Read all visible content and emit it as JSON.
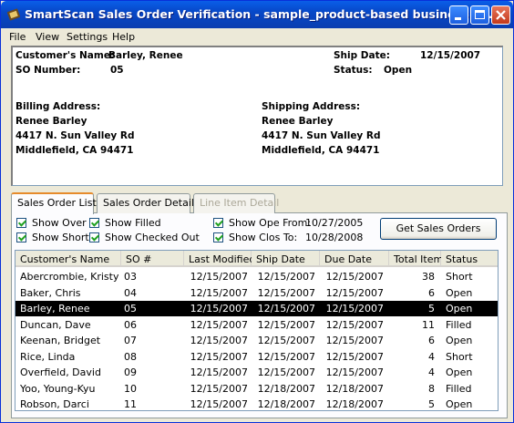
{
  "window": {
    "title": "SmartScan Sales Order Verification - sample_product-based business As...",
    "colors": {
      "titlebar": "#0a5ee8",
      "selected_row": "#000000",
      "window_bg": "#ece9d8"
    }
  },
  "menu": {
    "file": "File",
    "view": "View",
    "settings": "Settings",
    "help": "Help"
  },
  "order": {
    "customer_label": "Customer's Name:",
    "customer_value": "Barley, Renee",
    "so_label": "SO Number:",
    "so_value": "05",
    "ship_date_label": "Ship Date:",
    "ship_date_value": "12/15/2007",
    "status_label": "Status:",
    "status_value": "Open",
    "billing_label": "Billing Address:",
    "billing_lines": [
      "Renee Barley",
      "4417 N. Sun Valley Rd",
      "Middlefield, CA 94471"
    ],
    "shipping_label": "Shipping Address:",
    "shipping_lines": [
      "Renee Barley",
      "4417 N. Sun Valley Rd",
      "Middlefield, CA 94471"
    ]
  },
  "tabs": [
    "Sales Order List",
    "Sales Order Detail",
    "Line Item Detail"
  ],
  "filters": {
    "show_over": "Show Over",
    "show_short": "Show Short",
    "show_filled": "Show Filled",
    "show_checked_out": "Show Checked Out",
    "show_open_from": "Show Ope From:",
    "open_from_date": "10/27/2005",
    "show_closed_to": "Show Clos To:",
    "closed_to_date": "10/28/2008",
    "get_orders": "Get Sales Orders"
  },
  "table": {
    "columns": [
      "Customer's Name",
      "SO #",
      "Last Modified",
      "Ship Date",
      "Due Date",
      "Total Item",
      "Status"
    ],
    "rows": [
      [
        "Abercrombie, Kristy",
        "03",
        "12/15/2007",
        "12/15/2007",
        "12/15/2007",
        "38",
        "Short"
      ],
      [
        "Baker, Chris",
        "04",
        "12/15/2007",
        "12/15/2007",
        "12/15/2007",
        "6",
        "Open"
      ],
      [
        "Barley, Renee",
        "05",
        "12/15/2007",
        "12/15/2007",
        "12/15/2007",
        "5",
        "Open"
      ],
      [
        "Duncan, Dave",
        "06",
        "12/15/2007",
        "12/15/2007",
        "12/15/2007",
        "11",
        "Filled"
      ],
      [
        "Keenan, Bridget",
        "07",
        "12/15/2007",
        "12/15/2007",
        "12/15/2007",
        "6",
        "Open"
      ],
      [
        "Rice, Linda",
        "08",
        "12/15/2007",
        "12/15/2007",
        "12/15/2007",
        "4",
        "Short"
      ],
      [
        "Overfield, David",
        "09",
        "12/15/2007",
        "12/15/2007",
        "12/15/2007",
        "4",
        "Open"
      ],
      [
        "Yoo, Young-Kyu",
        "10",
        "12/15/2007",
        "12/18/2007",
        "12/18/2007",
        "8",
        "Filled"
      ],
      [
        "Robson, Darci",
        "11",
        "12/15/2007",
        "12/18/2007",
        "12/18/2007",
        "5",
        "Open"
      ]
    ],
    "selected_row": 2
  }
}
